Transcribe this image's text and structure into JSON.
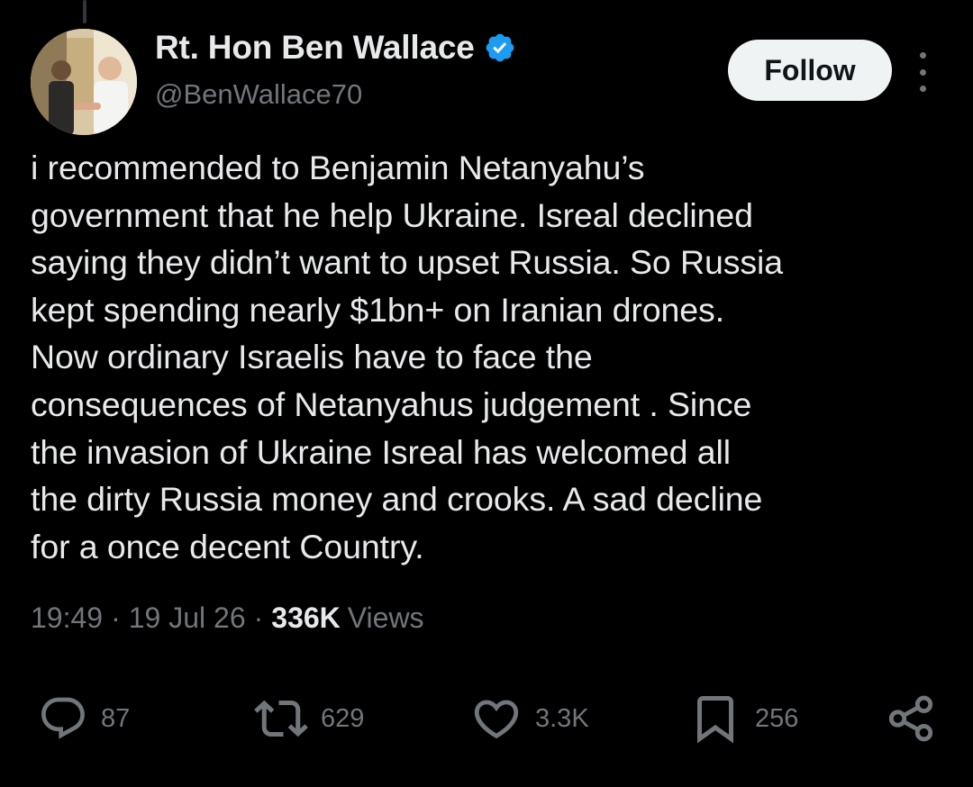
{
  "author": {
    "display_name": "Rt. Hon Ben Wallace",
    "handle": "@BenWallace70",
    "verified": true,
    "verified_color": "#1d9bf0"
  },
  "follow_label": "Follow",
  "tweet": {
    "text": "i recommended to Benjamin Netanyahu’s\ngovernment that he help Ukraine. Isreal declined\nsaying they didn’t want to upset Russia. So Russia\nkept spending nearly $1bn+ on Iranian drones.\nNow ordinary Israelis have to face the\nconsequences of Netanyahus judgement . Since\nthe invasion of Ukraine Isreal has welcomed all\nthe dirty Russia money and crooks. A sad decline\nfor a once decent Country.",
    "time": "19:49",
    "date": "19 Jul 26",
    "views_count": "336K",
    "views_label": "Views"
  },
  "actions": {
    "replies": "87",
    "reposts": "629",
    "likes": "3.3K",
    "bookmarks": "256"
  },
  "icons": {
    "reply": "speech-bubble-icon",
    "repost": "repost-arrows-icon",
    "like": "heart-icon",
    "bookmark": "bookmark-icon",
    "share": "share-nodes-icon",
    "more": "vertical-ellipsis-icon"
  }
}
